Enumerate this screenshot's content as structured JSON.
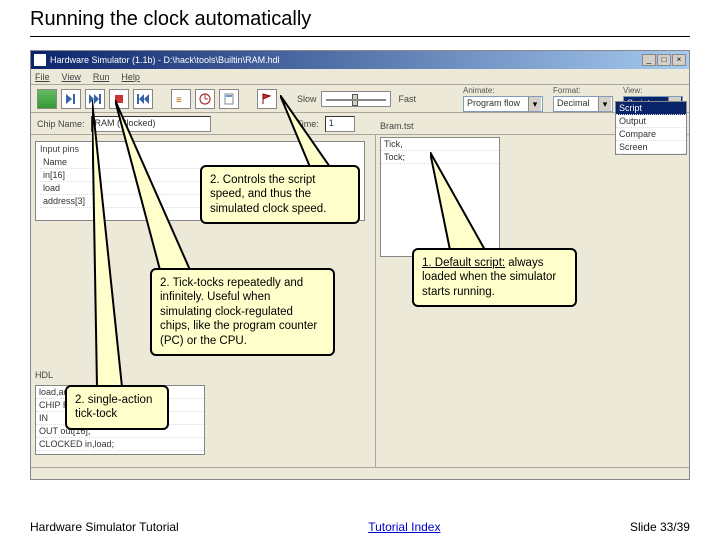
{
  "title": "Running the clock automatically",
  "window": {
    "title": "Hardware Simulator (1.1b) - D:\\hack\\tools\\Builtin\\RAM.hdl",
    "menu": {
      "file": "File",
      "view": "View",
      "run": "Run",
      "help": "Help"
    },
    "slider": {
      "slow": "Slow",
      "fast": "Fast"
    },
    "dropdowns": {
      "animate_label": "Animate:",
      "animate_value": "Program flow",
      "format_label": "Format:",
      "format_value": "Decimal",
      "view_label": "View:",
      "view_value": "Script",
      "view_options": [
        "Script",
        "Output",
        "Compare",
        "Screen"
      ]
    },
    "chip_label": "Chip Name:",
    "chip_value": "RAM (Clocked)",
    "time_label": "Time:",
    "time_value": "1",
    "inputs_title": "Input pins",
    "inputs_rows": [
      "Name",
      "in[16]",
      "load",
      "address[3]"
    ],
    "hdl_title": "HDL",
    "hdl_lines": [
      "load,address[3];",
      "CHIP RAM8 {",
      "  IN",
      "  OUT out[16];",
      "  CLOCKED in,load;"
    ],
    "script_title": "Bram.tst",
    "script_lines": [
      "Tick,",
      "Tock;"
    ]
  },
  "callouts": {
    "c1": "2. Controls the script speed, and thus the simulated clock speed.",
    "c2": "2. Tick-tocks repeatedly and infinitely. Useful when simulating clock-regulated chips, like the program counter (PC) or the CPU.",
    "c3": "2. single-action tick-tock",
    "c4_head": "1. Default script:",
    "c4_body": " always loaded when the simulator starts running."
  },
  "footer": {
    "left": "Hardware Simulator Tutorial",
    "center": "Tutorial Index",
    "right": "Slide 33/39"
  }
}
